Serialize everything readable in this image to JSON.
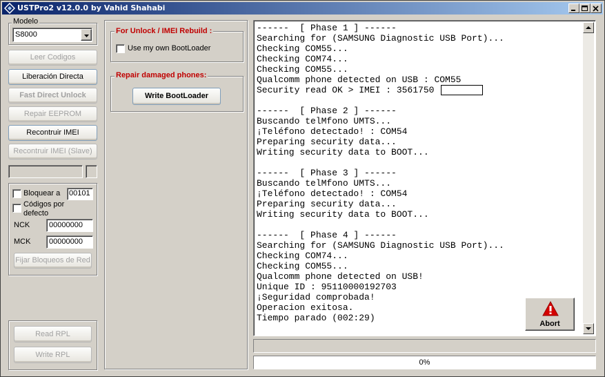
{
  "window": {
    "title": "USTPro2 v12.0.0   by Vahid Shahabi",
    "minimize": "_",
    "maximize": "□",
    "close": "×"
  },
  "model": {
    "caption": "Modelo",
    "selected": "S8000"
  },
  "left_buttons": {
    "leer_codigos": "Leer Codigos",
    "liberacion_directa": "Liberación Directa",
    "fast_direct_unlock": "Fast Direct Unlock",
    "repair_eeprom": "Repair EEPROM",
    "reconstruir_imei": "Recontruir IMEI",
    "reconstruir_imei_slave": "Recontruir IMEI (Slave)"
  },
  "lock_settings": {
    "bloquear_label": "Bloquear a",
    "bloquear_value": "00101",
    "codigos_label_1": "Códigos por",
    "codigos_label_2": "defecto",
    "nck_label": "NCK",
    "nck_value": "00000000",
    "mck_label": "MCK",
    "mck_value": "00000000",
    "fijar_button": "Fijar Bloqueos de Red"
  },
  "rpl": {
    "read": "Read RPL",
    "write": "Write RPL"
  },
  "unlock_group": {
    "caption": "For Unlock / IMEI Rebuild :",
    "checkbox_label": "Use my own BootLoader"
  },
  "repair_group": {
    "caption": "Repair damaged phones:",
    "button": "Write BootLoader"
  },
  "log_lines": [
    "------  [ Phase 1 ] ------",
    "Searching for (SAMSUNG Diagnostic USB Port)...",
    "Checking COM55...",
    "Checking COM74...",
    "Checking COM55...",
    "Qualcomm phone detected on USB : COM55",
    "Security read OK > IMEI : 3561750",
    "",
    "------  [ Phase 2 ] ------",
    "Buscando telMfono UMTS...",
    "¡Teléfono detectado! : COM54",
    "Preparing security data...",
    "Writing security data to BOOT...",
    "",
    "------  [ Phase 3 ] ------",
    "Buscando telMfono UMTS...",
    "¡Teléfono detectado! : COM54",
    "Preparing security data...",
    "Writing security data to BOOT...",
    "",
    "------  [ Phase 4 ] ------",
    "Searching for (SAMSUNG Diagnostic USB Port)...",
    "Checking COM74...",
    "Checking COM55...",
    "Qualcomm phone detected on USB!",
    "Unique ID : 95110000192703",
    "¡Seguridad comprobada!",
    "Operacion exitosa.",
    "Tiempo parado (002:29)"
  ],
  "abort_label": "Abort",
  "status_text": "",
  "progress": {
    "label": "0%",
    "value": 0
  },
  "colors": {
    "group_caption": "#c00000",
    "title_gradient_start": "#0a246a",
    "title_gradient_end": "#a6caf0",
    "abort_icon": "#d40000"
  }
}
